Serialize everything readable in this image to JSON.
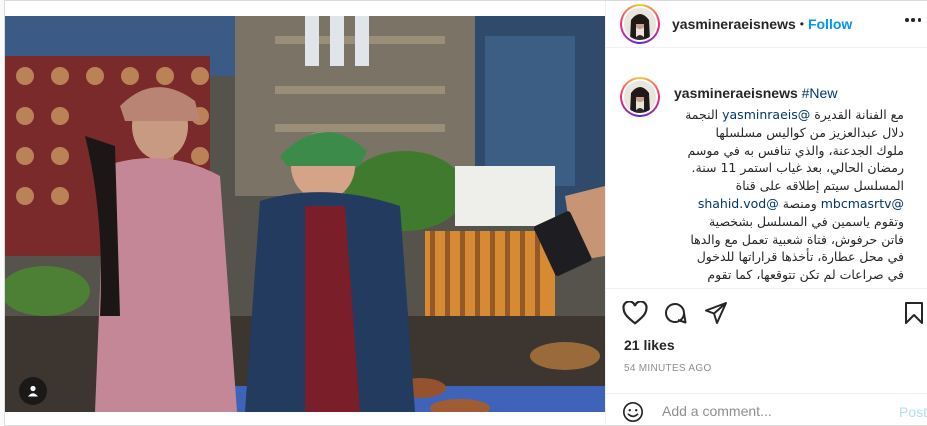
{
  "header": {
    "username": "yasmineraeisnews",
    "separator": "•",
    "follow_label": "Follow",
    "more_icon": "more-horizontal-icon"
  },
  "caption": {
    "username": "yasmineraeisnews",
    "hashtag": "#New",
    "line1": "مع الفنانة القديرة",
    "mention1": "@yasminraeis",
    "line1b": "النجمة",
    "line2": "دلال عبدالعزيز من كواليس مسلسلها",
    "line3": "ملوك الجدعنة، والذي تنافس به في موسم",
    "line4": "رمضان الحالي، بعد غياب استمر 11 سنة.",
    "line5": "المسلسل سيتم إطلاقه على قناة",
    "mention2": "@mbcmasrtv",
    "line6": "ومنصة",
    "mention3": "@shahid.vod",
    "line7": "وتقوم ياسمين في المسلسل بشخصية",
    "line8": "فاتن حرفوش، فتاة شعبية تعمل مع والدها",
    "line9": "في محل عطارة، تأخذها قراراتها للدخول",
    "line10": "في صراعات لم تكن تتوقعها، كما تقوم"
  },
  "actions": {
    "like_icon": "heart-icon",
    "comment_icon": "comment-icon",
    "share_icon": "paper-plane-icon",
    "save_icon": "bookmark-icon"
  },
  "likes": "21 likes",
  "timestamp": "54 MINUTES AGO",
  "comment": {
    "placeholder": "Add a comment...",
    "post_label": "Post",
    "emoji_icon": "smiley-icon"
  },
  "photo": {
    "tag_icon": "user-tag-icon"
  },
  "colors": {
    "link_blue": "#0095f6",
    "hashtag": "#00376b",
    "post_disabled": "#b2dffc",
    "meta_gray": "#8e8e8e"
  }
}
